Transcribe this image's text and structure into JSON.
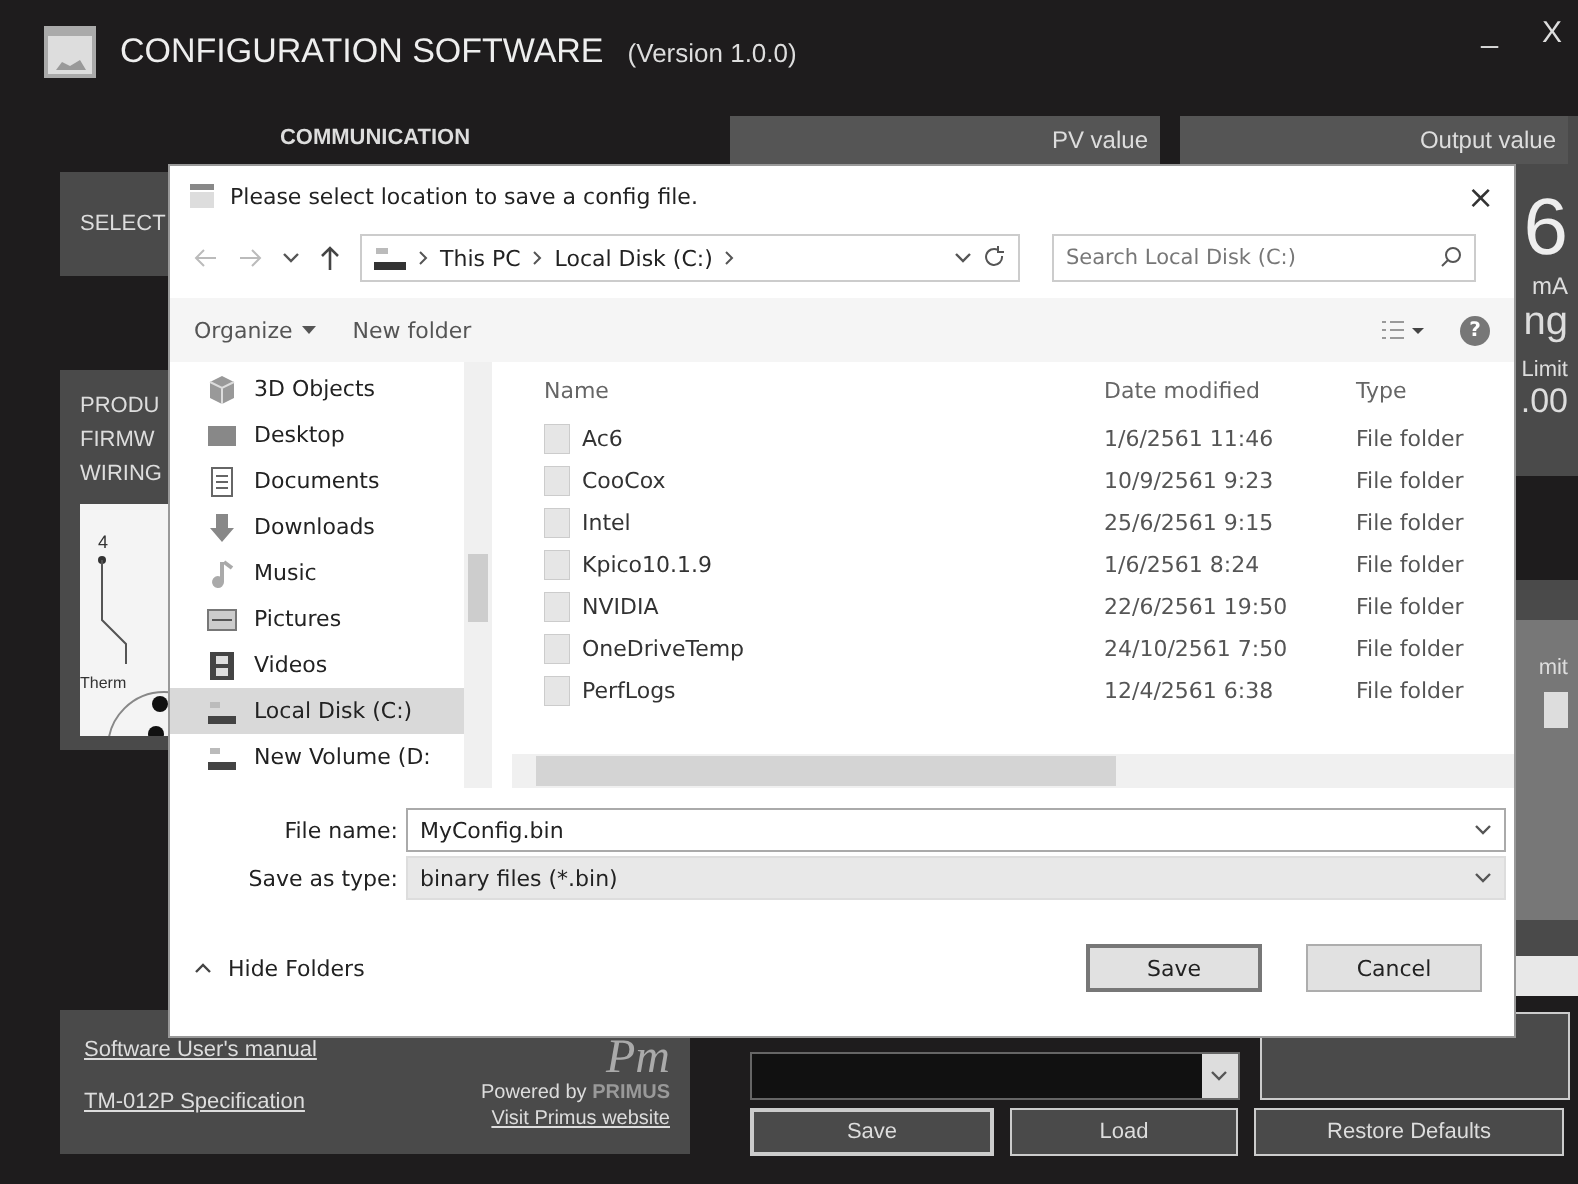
{
  "window": {
    "title": "CONFIGURATION SOFTWARE",
    "version": "(Version 1.0.0)",
    "minimize": "_",
    "close": "X"
  },
  "communication": {
    "heading": "COMMUNICATION",
    "select_label": "SELECT"
  },
  "product": {
    "lines": [
      "PRODU",
      "FIRMW",
      "WIRING"
    ],
    "diagram_labels": [
      "4",
      "Therm"
    ]
  },
  "footer": {
    "links": [
      "Software  User's  manual",
      "TM-012P  Specification"
    ],
    "powered_by": "Powered by",
    "logo_text": "Pm",
    "brand": "PRIMUS",
    "website_link": "Visit Primus website"
  },
  "pv_panel": {
    "header": "PV value"
  },
  "output_panel": {
    "header": "Output value",
    "value": "6",
    "unit": "mA",
    "status": "ng",
    "limit_label": "Limit",
    "limit_value": ".00"
  },
  "settings_panel": {
    "label": "mit"
  },
  "buttons": [
    "Save",
    "Load",
    "Restore Defaults"
  ],
  "dialog": {
    "title": "Please select location to save a config file.",
    "close": "×",
    "breadcrumb": [
      "This PC",
      "Local Disk (C:)"
    ],
    "search_placeholder": "Search Local Disk (C:)",
    "organize": "Organize",
    "new_folder": "New folder",
    "help": "?",
    "sidebar": [
      {
        "label": "3D Objects",
        "kind": "cube",
        "selected": false
      },
      {
        "label": "Desktop",
        "kind": "desktop",
        "selected": false
      },
      {
        "label": "Documents",
        "kind": "document",
        "selected": false
      },
      {
        "label": "Downloads",
        "kind": "download",
        "selected": false
      },
      {
        "label": "Music",
        "kind": "music",
        "selected": false
      },
      {
        "label": "Pictures",
        "kind": "pictures",
        "selected": false
      },
      {
        "label": "Videos",
        "kind": "video",
        "selected": false
      },
      {
        "label": "Local Disk (C:)",
        "kind": "drive",
        "selected": true
      },
      {
        "label": "New Volume (D:",
        "kind": "drive",
        "selected": false
      }
    ],
    "columns": [
      "Name",
      "Date modified",
      "Type"
    ],
    "rows": [
      {
        "name": "Ac6",
        "date": "1/6/2561 11:46",
        "type": "File folder"
      },
      {
        "name": "CooCox",
        "date": "10/9/2561 9:23",
        "type": "File folder"
      },
      {
        "name": "Intel",
        "date": "25/6/2561 9:15",
        "type": "File folder"
      },
      {
        "name": "Kpico10.1.9",
        "date": "1/6/2561 8:24",
        "type": "File folder"
      },
      {
        "name": "NVIDIA",
        "date": "22/6/2561 19:50",
        "type": "File folder"
      },
      {
        "name": "OneDriveTemp",
        "date": "24/10/2561 7:50",
        "type": "File folder"
      },
      {
        "name": "PerfLogs",
        "date": "12/4/2561 6:38",
        "type": "File folder"
      }
    ],
    "file_name": {
      "label": "File name:",
      "value": "MyConfig.bin"
    },
    "save_type": {
      "label": "Save as type:",
      "value": "binary files (*.bin)"
    },
    "hide_folders": "Hide Folders",
    "save": "Save",
    "cancel": "Cancel"
  }
}
